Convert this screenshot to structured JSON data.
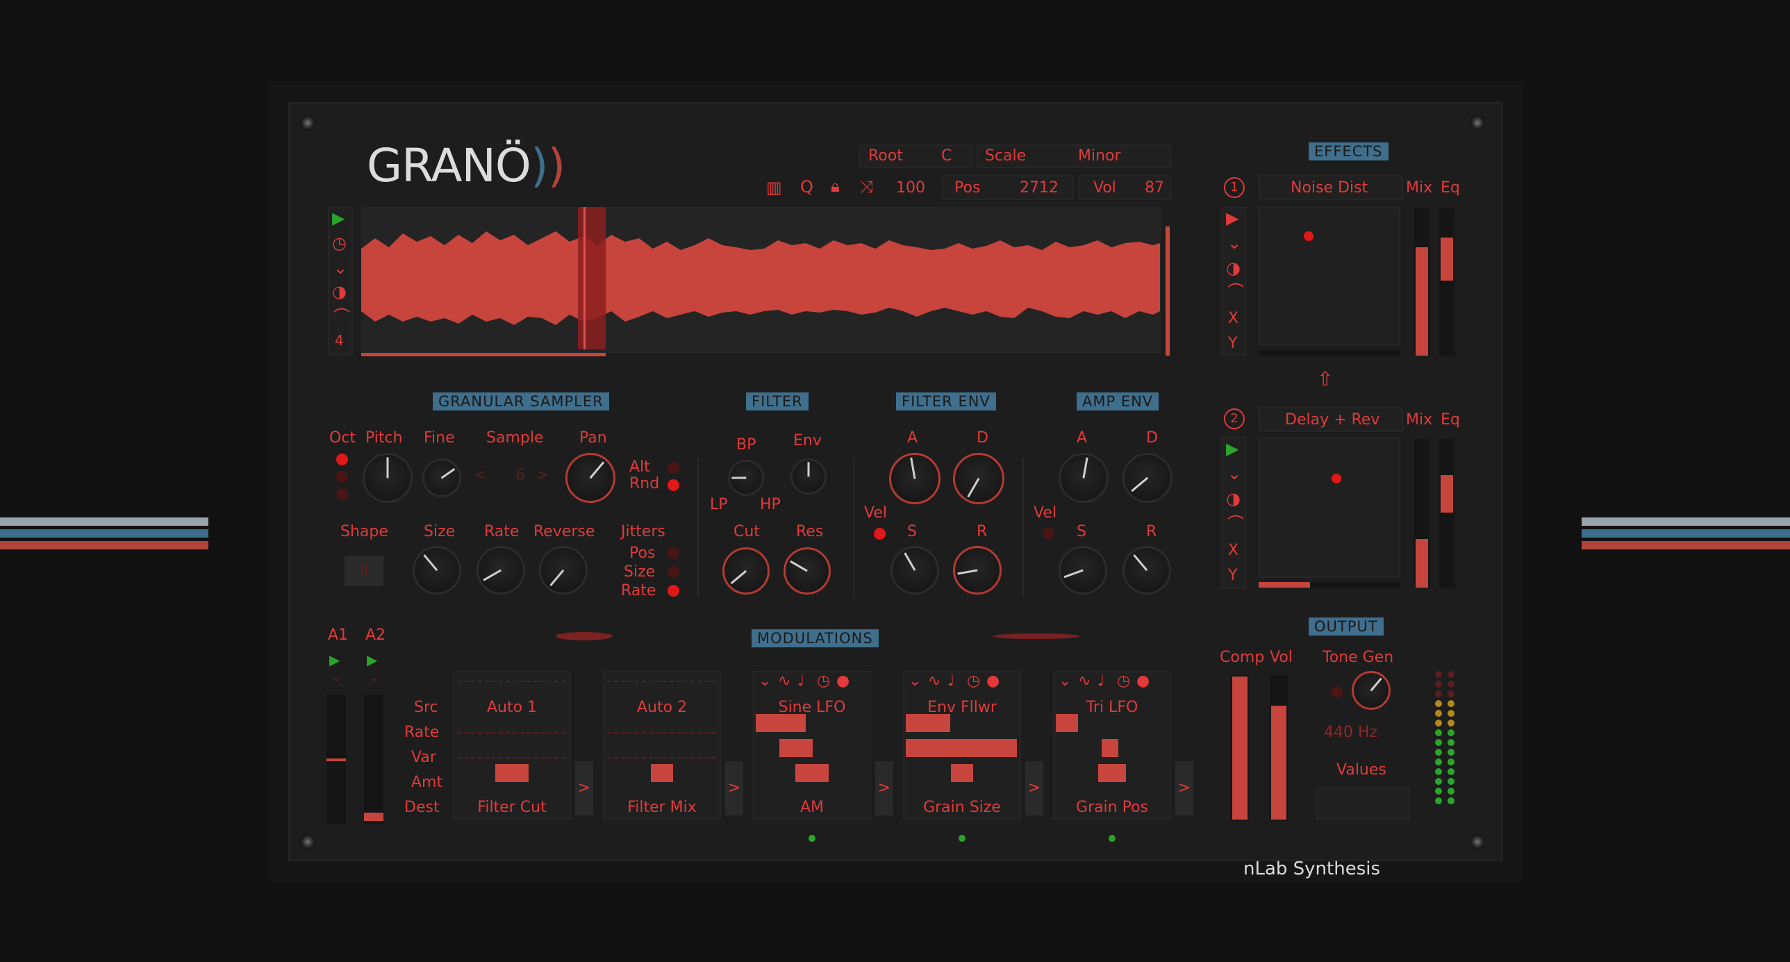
{
  "colors": {
    "accent": "#e23a3a",
    "waveform": "#c7453d",
    "section_label_bg": "#3f6f8c",
    "panel_bg": "#1d1d1d",
    "led_green": "#2aa52a"
  },
  "logo": "GRANÖ",
  "brand": "nLab Synthesis",
  "toolbar": {
    "root_label": "Root",
    "root_value": "C",
    "scale_label": "Scale",
    "scale_value": "Minor",
    "speed": "100",
    "pos_label": "Pos",
    "pos_value": "2712",
    "vol_label": "Vol",
    "vol_value": "87"
  },
  "waveform_side_icons": [
    "play-icon",
    "clock-icon",
    "chevron-down-icon",
    "half-circle-icon",
    "curve-icon",
    "four-icon"
  ],
  "sections": {
    "granular": "GRANULAR SAMPLER",
    "filter": "FILTER",
    "filter_env": "FILTER ENV",
    "amp_env": "AMP ENV",
    "modulations": "MODULATIONS",
    "effects": "EFFECTS",
    "output": "OUTPUT"
  },
  "granular": {
    "oct": "Oct",
    "pitch": "Pitch",
    "fine": "Fine",
    "sample": "Sample",
    "sample_value": "6",
    "pan": "Pan",
    "alt": "Alt",
    "rnd": "Rnd",
    "shape": "Shape",
    "size": "Size",
    "rate": "Rate",
    "reverse": "Reverse",
    "jitters": "Jitters",
    "j_pos": "Pos",
    "j_size": "Size",
    "j_rate": "Rate"
  },
  "filter": {
    "bp": "BP",
    "env": "Env",
    "lp": "LP",
    "hp": "HP",
    "cut": "Cut",
    "res": "Res"
  },
  "filter_env": {
    "a": "A",
    "d": "D",
    "vel": "Vel",
    "s": "S",
    "r": "R"
  },
  "amp_env": {
    "a": "A",
    "d": "D",
    "vel": "Vel",
    "s": "S",
    "r": "R"
  },
  "mod_rows": [
    "Src",
    "Rate",
    "Var",
    "Amt",
    "Dest"
  ],
  "aux": {
    "a1": "A1",
    "a2": "A2"
  },
  "mods": [
    {
      "src": "Auto 1",
      "dest": "Filter Cut",
      "rate": 0,
      "var": 0,
      "amt": 0.3
    },
    {
      "src": "Auto 2",
      "dest": "Filter Mix",
      "rate": 0,
      "var": 0,
      "amt": 0.2
    },
    {
      "src": "Sine LFO",
      "dest": "AM",
      "rate": 0.45,
      "var": 0.3,
      "amt": 0.3
    },
    {
      "src": "Env Fllwr",
      "dest": "Grain Size",
      "rate": 0.4,
      "var": 1.0,
      "amt": 0.2
    },
    {
      "src": "Tri LFO",
      "dest": "Grain Pos",
      "rate": 0.2,
      "var": 0.15,
      "amt": 0.25
    }
  ],
  "effects": {
    "slot1_num": "1",
    "slot1": "Noise Dist",
    "slot2_num": "2",
    "slot2": "Delay + Rev",
    "mix": "Mix",
    "eq": "Eq",
    "x": "X",
    "y": "Y"
  },
  "output": {
    "comp": "Comp",
    "vol": "Vol",
    "tone_gen": "Tone Gen",
    "freq": "440 Hz",
    "values": "Values"
  }
}
